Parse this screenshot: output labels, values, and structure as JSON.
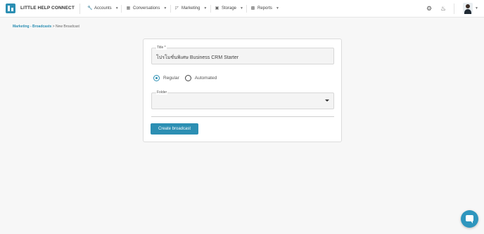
{
  "header": {
    "brand": "LITTLE HELP CONNECT",
    "nav": [
      {
        "label": "Accounts",
        "icon": "wrench-icon"
      },
      {
        "label": "Conversations",
        "icon": "chat-icon"
      },
      {
        "label": "Marketing",
        "icon": "megaphone-icon"
      },
      {
        "label": "Storage",
        "icon": "storage-icon"
      },
      {
        "label": "Reports",
        "icon": "chart-icon"
      }
    ],
    "icons": {
      "settings": "gear-icon",
      "notifications": "bell-icon"
    }
  },
  "breadcrumb": {
    "link": "Marketing - Broadcasts",
    "separator": " > ",
    "current": "New Broadcast"
  },
  "form": {
    "title_label": "Title *",
    "title_value": "โปรโมชั่นพิเศษ Business CRM Starter",
    "radio_options": [
      {
        "label": "Regular",
        "checked": true
      },
      {
        "label": "Automated",
        "checked": false
      }
    ],
    "folder_label": "Folder",
    "folder_value": "",
    "submit_label": "Create broadcast"
  },
  "colors": {
    "accent": "#2c8fb3",
    "chat_button": "#2f96be"
  }
}
